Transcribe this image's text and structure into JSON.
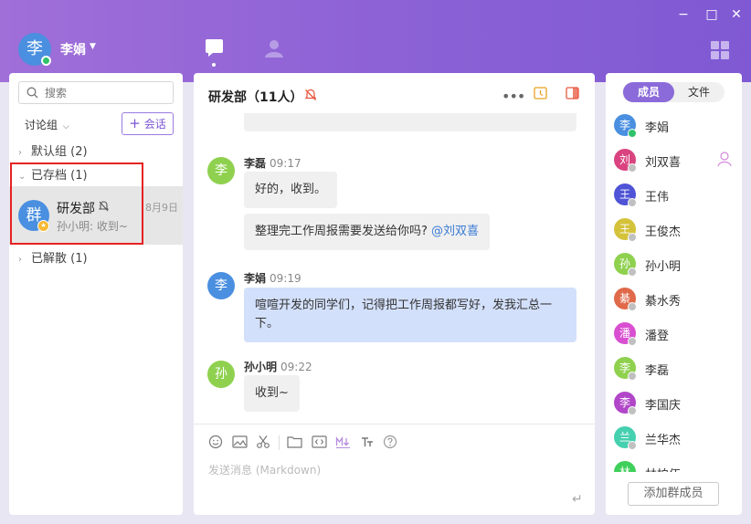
{
  "window": {
    "minimize": "−",
    "maximize": "□",
    "close": "✕"
  },
  "user": {
    "avatar_char": "李",
    "name": "李娟"
  },
  "left": {
    "search_placeholder": "搜索",
    "group_select": "讨论组",
    "new_chat_label": "会话",
    "groups": [
      {
        "label": "默认组 (2)",
        "expanded": false
      },
      {
        "label": "已存档 (1)",
        "expanded": true
      },
      {
        "label": "已解散 (1)",
        "expanded": false
      }
    ],
    "conversation": {
      "avatar_char": "群",
      "name": "研发部",
      "date": "8月9日",
      "preview": "孙小明: 收到~"
    }
  },
  "chat": {
    "title": "研发部（11人）",
    "messages": [
      {
        "sender": "李磊",
        "avatar_char": "李",
        "avatar_color": "#8fd14f",
        "time": "09:17",
        "texts": [
          "好的，收到。",
          "整理完工作周报需要发送给你吗?"
        ],
        "mention": "@刘双喜"
      },
      {
        "sender": "李娟",
        "avatar_char": "李",
        "avatar_color": "#4a8fe0",
        "time": "09:19",
        "text": "喧喧开发的同学们，记得把工作周报都写好，发我汇总一下。"
      },
      {
        "sender": "孙小明",
        "avatar_char": "孙",
        "avatar_color": "#8fd14f",
        "time": "09:22",
        "text": "收到~"
      }
    ],
    "composer_placeholder": "发送消息 (Markdown)",
    "send_symbol": "↵"
  },
  "members_panel": {
    "tab_members": "成员",
    "tab_files": "文件",
    "members": [
      {
        "name": "李娟",
        "char": "李",
        "color": "#4a8fe0",
        "online": true,
        "admin": false
      },
      {
        "name": "刘双喜",
        "char": "刘",
        "color": "#d9437f",
        "online": false,
        "admin": true
      },
      {
        "name": "王伟",
        "char": "王",
        "color": "#4f54d6",
        "online": false,
        "admin": false
      },
      {
        "name": "王俊杰",
        "char": "王",
        "color": "#d4c23a",
        "online": false,
        "admin": false
      },
      {
        "name": "孙小明",
        "char": "孙",
        "color": "#8fd14f",
        "online": false,
        "admin": false
      },
      {
        "name": "綦水秀",
        "char": "綦",
        "color": "#e0694a",
        "online": false,
        "admin": false
      },
      {
        "name": "潘登",
        "char": "潘",
        "color": "#d94fd1",
        "online": false,
        "admin": false
      },
      {
        "name": "李磊",
        "char": "李",
        "color": "#8fd14f",
        "online": false,
        "admin": false
      },
      {
        "name": "李国庆",
        "char": "李",
        "color": "#b146c9",
        "online": false,
        "admin": false
      },
      {
        "name": "兰华杰",
        "char": "兰",
        "color": "#45d0b0",
        "online": false,
        "admin": false
      },
      {
        "name": "林柏伍",
        "char": "林",
        "color": "#3ed05a",
        "online": false,
        "admin": false
      }
    ],
    "add_member_label": "添加群成员"
  }
}
